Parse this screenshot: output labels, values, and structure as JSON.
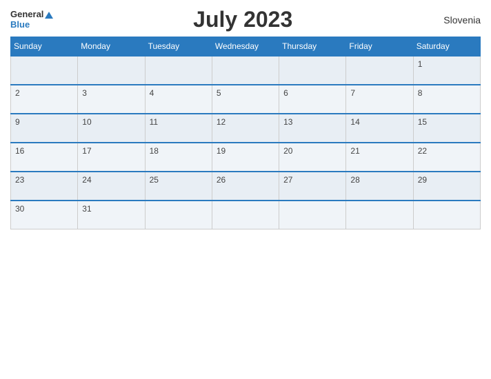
{
  "header": {
    "logo_general": "General",
    "logo_blue": "Blue",
    "title": "July 2023",
    "country": "Slovenia"
  },
  "days": [
    "Sunday",
    "Monday",
    "Tuesday",
    "Wednesday",
    "Thursday",
    "Friday",
    "Saturday"
  ],
  "weeks": [
    [
      "",
      "",
      "",
      "",
      "",
      "",
      "1"
    ],
    [
      "2",
      "3",
      "4",
      "5",
      "6",
      "7",
      "8"
    ],
    [
      "9",
      "10",
      "11",
      "12",
      "13",
      "14",
      "15"
    ],
    [
      "16",
      "17",
      "18",
      "19",
      "20",
      "21",
      "22"
    ],
    [
      "23",
      "24",
      "25",
      "26",
      "27",
      "28",
      "29"
    ],
    [
      "30",
      "31",
      "",
      "",
      "",
      "",
      ""
    ]
  ]
}
